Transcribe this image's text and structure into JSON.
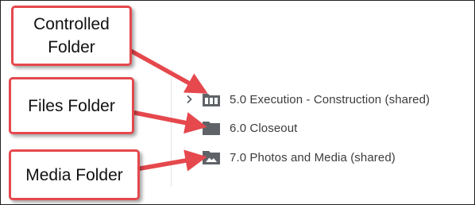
{
  "callouts": {
    "controlled": {
      "line1": "Controlled",
      "line2": "Folder"
    },
    "files": {
      "label": "Files Folder"
    },
    "media": {
      "label": "Media Folder"
    }
  },
  "tree": {
    "items": [
      {
        "label": "5.0 Execution - Construction (shared)",
        "icon": "controlled-folder-icon",
        "expandable": true
      },
      {
        "label": "6.0 Closeout",
        "icon": "folder-icon",
        "expandable": false
      },
      {
        "label": "7.0 Photos and Media (shared)",
        "icon": "media-folder-icon",
        "expandable": false
      }
    ]
  },
  "colors": {
    "callout_border": "#e5484d",
    "arrow": "#e5484d",
    "icon": "#5f6368",
    "text": "#3c3c3c"
  }
}
